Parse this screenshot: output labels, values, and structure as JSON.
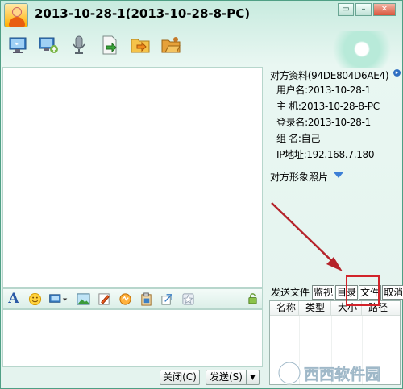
{
  "window": {
    "title": "2013-10-28-1(2013-10-28-8-PC)",
    "accent_color": "#4f9f85",
    "controls": [
      "restore-icon",
      "minimize-icon",
      "close-icon"
    ]
  },
  "toolbar": {
    "tools": [
      "remote-desktop-icon",
      "remote-assist-icon",
      "microphone-icon",
      "send-file-icon",
      "send-folder-icon",
      "shared-folder-icon"
    ]
  },
  "contact_info": {
    "header": "对方资料(94DE804D6AE4)",
    "rows": [
      "用户名:2013-10-28-1",
      "主  机:2013-10-28-8-PC",
      "登录名:2013-10-28-1",
      "组  名:自己",
      "IP地址:192.168.7.180"
    ],
    "photo_label": "对方形象照片"
  },
  "format_bar": {
    "tools": [
      "font-icon",
      "emoji-icon",
      "screenshot-icon",
      "image-icon",
      "handwriting-icon",
      "shake-icon",
      "clipboard-icon",
      "shortcut-reply-icon",
      "sticker-icon"
    ],
    "font_glyph": "A"
  },
  "buttons": {
    "close": "关闭(C)",
    "send": "发送(S)",
    "send_arrow": "▼"
  },
  "file_transfer": {
    "label": "发送文件",
    "tabs": [
      "监视",
      "目录",
      "文件",
      "取消"
    ],
    "columns": [
      "名称",
      "类型",
      "大小",
      "路径"
    ],
    "highlight_color": "#d2232a"
  },
  "watermark": "西西软件园"
}
